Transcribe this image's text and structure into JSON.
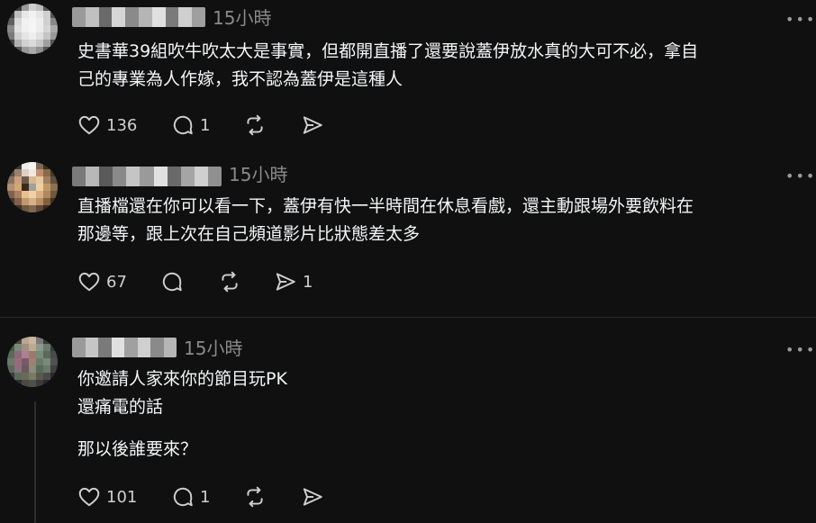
{
  "comments": [
    {
      "time": "15小時",
      "text_lines": [
        "史書華39組吹牛吹太大是事實，但都開直播了還要說蓋伊放水真的大可不必，拿自",
        "己的專業為人作嫁，我不認為蓋伊是這種人"
      ],
      "likes": "136",
      "replies": "1",
      "reposts": "",
      "shares": ""
    },
    {
      "time": "15小時",
      "text_lines": [
        "直播檔還在你可以看一下，蓋伊有快一半時間在休息看戲，還主動跟場外要飲料在",
        "那邊等，跟上次在自己頻道影片比狀態差太多"
      ],
      "likes": "67",
      "replies": "",
      "reposts": "",
      "shares": "1"
    },
    {
      "time": "15小時",
      "text_lines": [
        "你邀請人家來你的節目玩PK",
        "還痛電的話"
      ],
      "text_extra": "那以後誰要來？",
      "likes": "101",
      "replies": "1",
      "reposts": "",
      "shares": ""
    }
  ],
  "more_label": "•••",
  "icons": [
    "heart-icon",
    "comment-icon",
    "repost-icon",
    "share-icon",
    "more-icon"
  ],
  "colors": {
    "background": "#101010",
    "text": "#f3f5f7",
    "muted": "#8a8a8a",
    "icon": "#cfcfcf"
  }
}
